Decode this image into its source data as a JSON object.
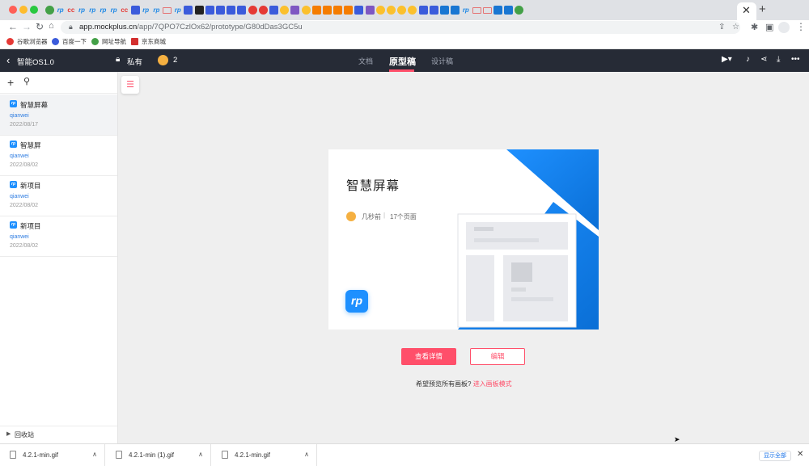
{
  "browser": {
    "url_host": "app.mockplus.cn",
    "url_path": "/app/7QPO7CzlOx62/prototype/G80dDas3GC5u",
    "active_tab_close": "✕",
    "new_tab": "+",
    "bookmarks": [
      {
        "label": "谷歌浏览器",
        "color": "#e53935"
      },
      {
        "label": "百度一下",
        "color": "#3b5bdb"
      },
      {
        "label": "网址导航",
        "color": "#43a047"
      },
      {
        "label": "京东商城",
        "color": "#d32f2f"
      }
    ]
  },
  "header": {
    "project_name": "智能OS1.0",
    "privacy_label": "私有",
    "member_count": "2",
    "tabs": [
      {
        "label": "文档",
        "active": false
      },
      {
        "label": "原型稿",
        "active": true
      },
      {
        "label": "设计稿",
        "active": false
      }
    ]
  },
  "sidebar": {
    "projects": [
      {
        "name": "智慧屏幕",
        "owner": "qianwei",
        "date": "2022/08/17",
        "selected": true
      },
      {
        "name": "智慧屏",
        "owner": "qianwei",
        "date": "2022/08/02",
        "selected": false
      },
      {
        "name": "新项目",
        "owner": "qianwei",
        "date": "2022/08/02",
        "selected": false
      },
      {
        "name": "新项目",
        "owner": "qianwei",
        "date": "2022/08/02",
        "selected": false
      }
    ],
    "trash_label": "回收站"
  },
  "card": {
    "title": "智慧屏幕",
    "updated": "几秒前",
    "separator": "|",
    "pages": "17个页面",
    "logo": "rp",
    "accent": "#1e90ff"
  },
  "actions": {
    "view_label": "查看详情",
    "edit_label": "编辑",
    "hint_text": "希望预览所有画板?",
    "hint_link": "进入画板模式"
  },
  "downloads": {
    "items": [
      {
        "name": "4.2.1-min.gif"
      },
      {
        "name": "4.2.1-min (1).gif"
      },
      {
        "name": "4.2.1-min.gif"
      }
    ],
    "show_all_label": "显示全部"
  },
  "colors": {
    "brand": "#ff4f6a",
    "header_bg": "#262b36",
    "rp_blue": "#1e90ff"
  }
}
